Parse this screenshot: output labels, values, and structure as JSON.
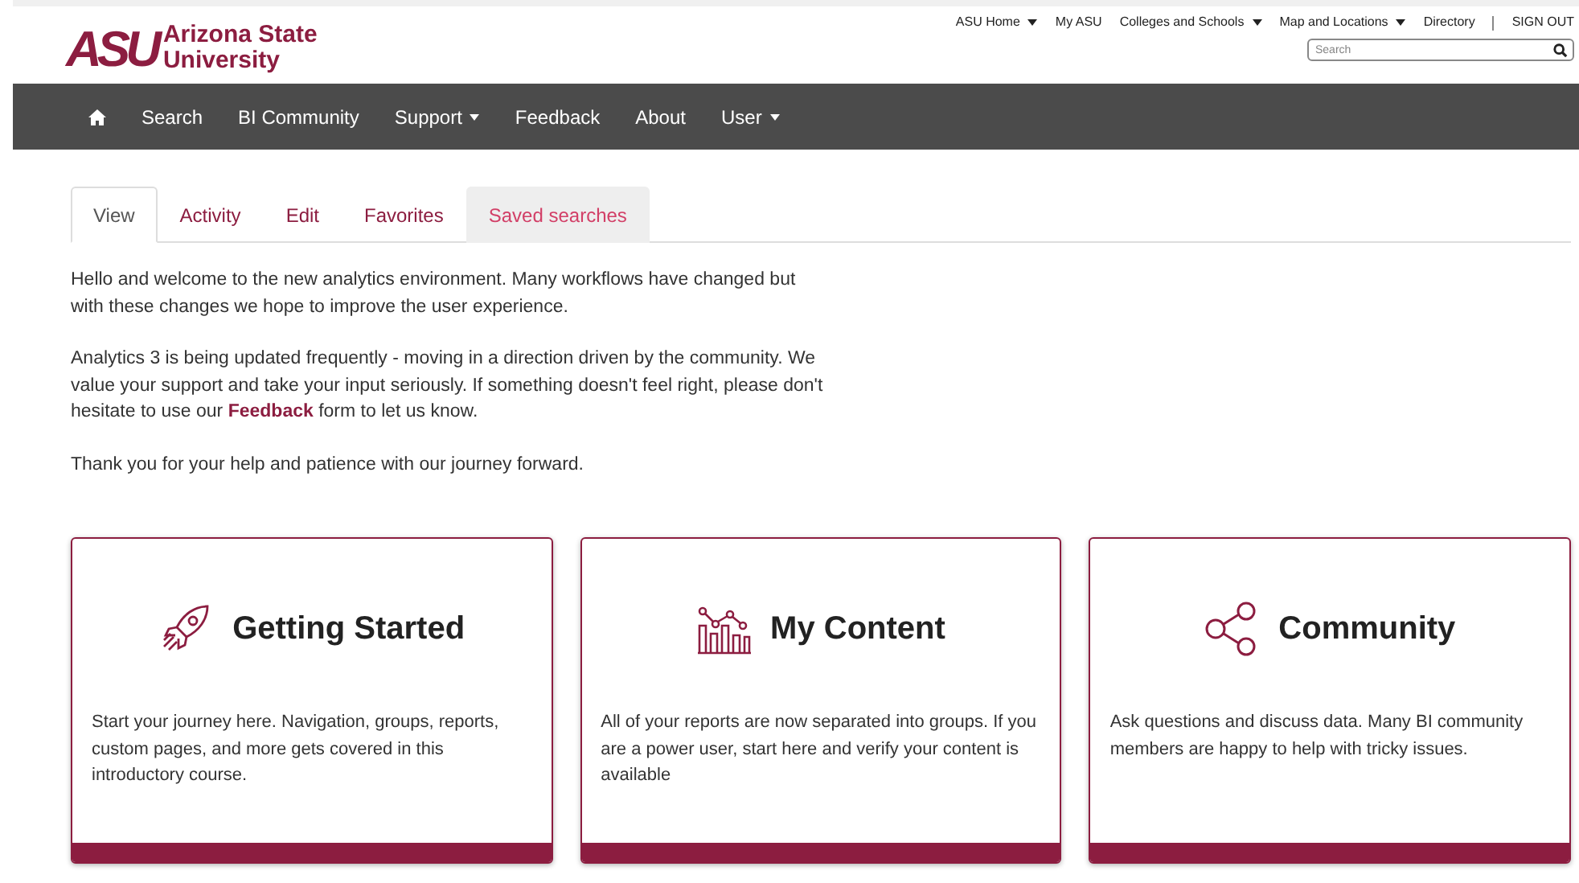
{
  "logo": {
    "mark": "ASU",
    "name_lines": [
      "Arizona State",
      "University"
    ]
  },
  "top_links": [
    {
      "label": "ASU Home",
      "dropdown": true
    },
    {
      "label": "My ASU",
      "dropdown": false
    },
    {
      "label": "Colleges and Schools",
      "dropdown": true
    },
    {
      "label": "Map and Locations",
      "dropdown": true
    },
    {
      "label": "Directory",
      "dropdown": false
    },
    {
      "label": "SIGN OUT",
      "dropdown": false
    }
  ],
  "site_search": {
    "placeholder": "Search"
  },
  "nav": [
    {
      "kind": "home"
    },
    {
      "kind": "link",
      "label": "Search",
      "dropdown": false
    },
    {
      "kind": "link",
      "label": "BI Community",
      "dropdown": false
    },
    {
      "kind": "link",
      "label": "Support",
      "dropdown": true
    },
    {
      "kind": "link",
      "label": "Feedback",
      "dropdown": false
    },
    {
      "kind": "link",
      "label": "About",
      "dropdown": false
    },
    {
      "kind": "link",
      "label": "User",
      "dropdown": true
    }
  ],
  "tabs": [
    {
      "label": "View",
      "selected": true,
      "hovered": false
    },
    {
      "label": "Activity",
      "selected": false,
      "hovered": false
    },
    {
      "label": "Edit",
      "selected": false,
      "hovered": false
    },
    {
      "label": "Favorites",
      "selected": false,
      "hovered": false
    },
    {
      "label": "Saved searches",
      "selected": false,
      "hovered": true
    }
  ],
  "paragraphs": [
    {
      "text": "Hello and welcome to the new analytics environment. Many workflows have changed but with these changes we hope to improve the user experience."
    },
    {
      "text": "Analytics 3 is being updated frequently - moving in a direction driven by the community. We value your support and take your input seriously. If something doesn't feel right, please don't hesitate to use our",
      "link": "Feedback",
      "after": "form to let us know."
    },
    {
      "text": "Thank you for your help and patience with our journey forward."
    }
  ],
  "cards": [
    {
      "kind": "rocket",
      "title": "Getting Started",
      "text": "Start your journey here. Navigation, groups, reports, custom pages, and more gets covered in this introductory course."
    },
    {
      "kind": "chart",
      "title": "My Content",
      "text": "All of your reports are now separated into groups. If you are a power user, start here and verify your content is available"
    },
    {
      "kind": "share",
      "title": "Community",
      "text": "Ask questions and discuss data. Many BI community members are happy to help with tricky issues."
    }
  ]
}
